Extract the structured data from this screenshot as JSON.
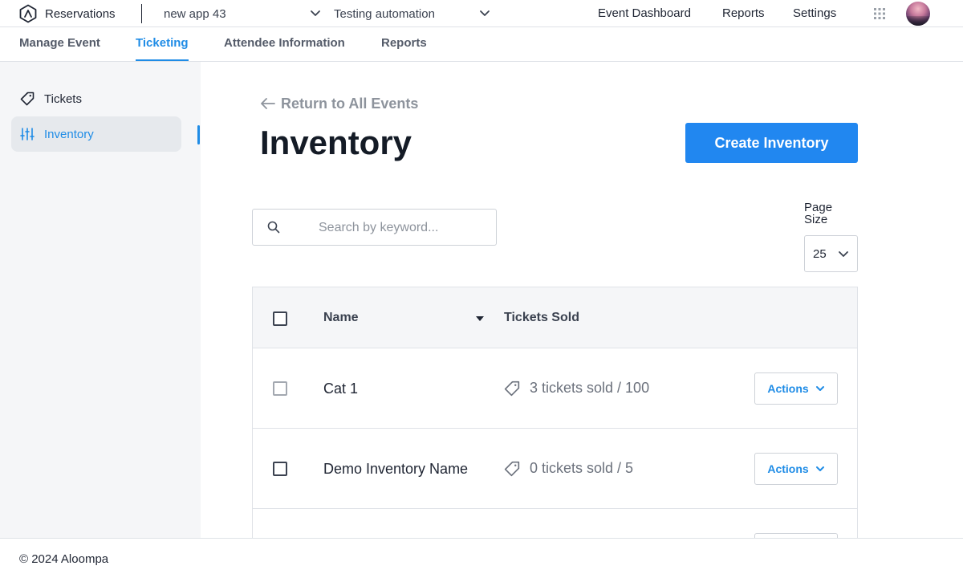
{
  "header": {
    "app_name": "Reservations",
    "app_selector_value": "new app 43",
    "event_selector_value": "Testing automation",
    "nav": {
      "event_dashboard": "Event Dashboard",
      "reports": "Reports",
      "settings": "Settings"
    }
  },
  "tabs": [
    {
      "label": "Manage Event",
      "active": false
    },
    {
      "label": "Ticketing",
      "active": true
    },
    {
      "label": "Attendee Information",
      "active": false
    },
    {
      "label": "Reports",
      "active": false
    }
  ],
  "sidebar": {
    "items": [
      {
        "label": "Tickets",
        "icon": "ticket-icon",
        "active": false
      },
      {
        "label": "Inventory",
        "icon": "sliders-icon",
        "active": true
      }
    ]
  },
  "main": {
    "back_link": "Return to All Events",
    "title": "Inventory",
    "create_button": "Create Inventory",
    "search": {
      "placeholder": "Search by keyword...",
      "value": ""
    },
    "page_size": {
      "label": "Page Size",
      "value": "25"
    }
  },
  "table": {
    "columns": {
      "name": "Name",
      "tickets_sold": "Tickets Sold"
    },
    "rows": [
      {
        "name": "Cat 1",
        "tickets_sold": "3 tickets sold / 100",
        "action_label": "Actions"
      },
      {
        "name": "Demo Inventory Name",
        "tickets_sold": "0 tickets sold / 5",
        "action_label": "Actions"
      }
    ]
  },
  "footer": {
    "text": "© 2024 Aloompa"
  },
  "colors": {
    "accent": "#1f8ce6",
    "primary_button": "#2187f0",
    "sidebar_bg": "#f5f6f8"
  }
}
